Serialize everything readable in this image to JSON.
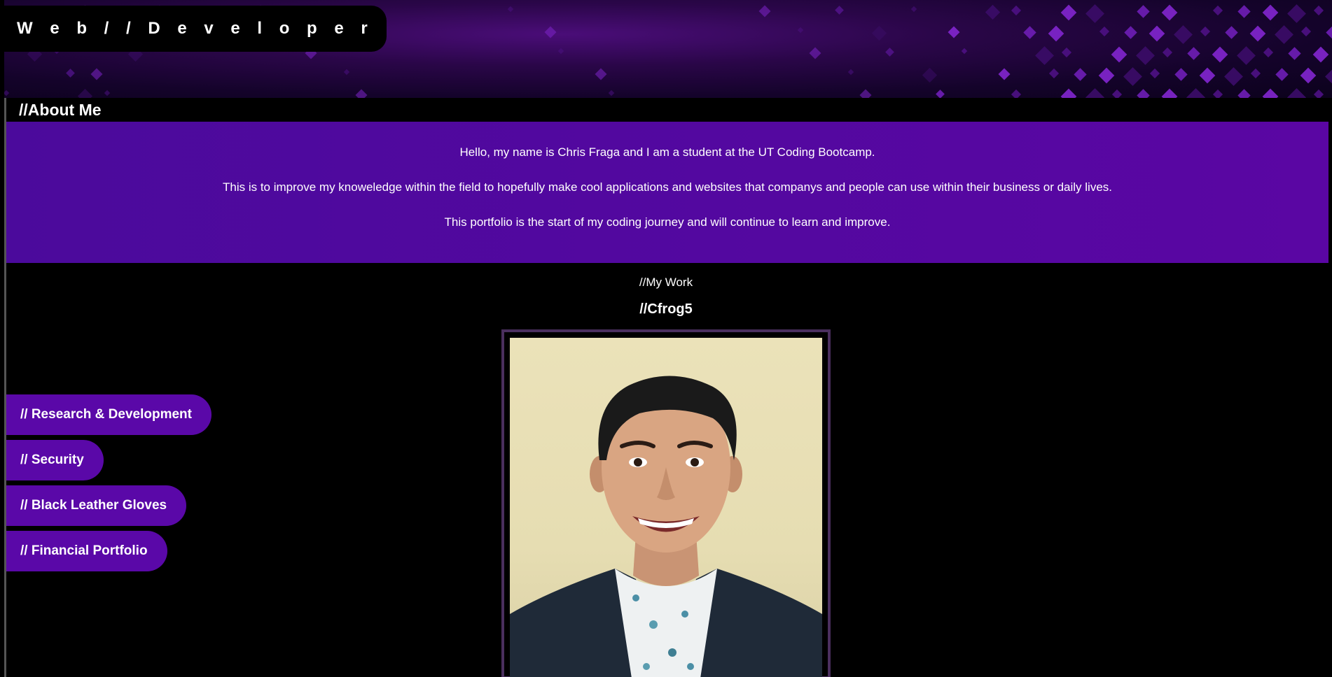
{
  "header": {
    "brand": "W e b / / D e v e l o p e r"
  },
  "about": {
    "title": "//About Me",
    "paragraphs": [
      "Hello, my name is Chris Fraga and I am a student at the UT Coding Bootcamp.",
      "This is to improve my knoweledge within the field to hopefully make cool applications and websites that companys and people can use within their business or daily lives.",
      "This portfolio is the start of my coding journey and will continue to learn and improve."
    ]
  },
  "work": {
    "label": "//My Work",
    "handle": "//Cfrog5"
  },
  "nav": {
    "items": [
      {
        "label": "// Research & Development"
      },
      {
        "label": "// Security"
      },
      {
        "label": "// Black Leather Gloves"
      },
      {
        "label": "// Financial Portfolio"
      }
    ]
  },
  "colors": {
    "accent_purple": "#5a08a8",
    "background": "#000000",
    "frame": "#4a2f5e"
  }
}
